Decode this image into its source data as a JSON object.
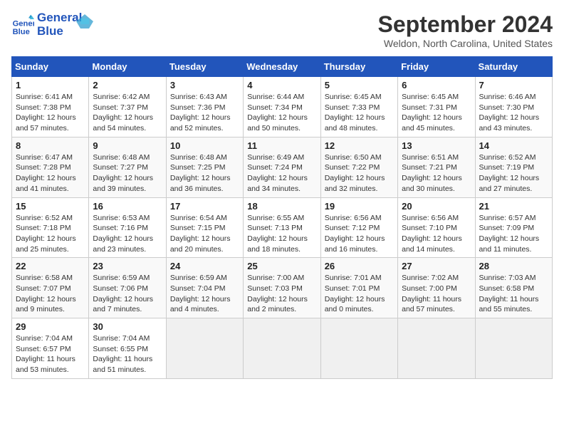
{
  "logo": {
    "line1": "General",
    "line2": "Blue"
  },
  "title": "September 2024",
  "location": "Weldon, North Carolina, United States",
  "weekdays": [
    "Sunday",
    "Monday",
    "Tuesday",
    "Wednesday",
    "Thursday",
    "Friday",
    "Saturday"
  ],
  "weeks": [
    [
      {
        "day": "1",
        "sunrise": "6:41 AM",
        "sunset": "7:38 PM",
        "daylight": "12 hours and 57 minutes."
      },
      {
        "day": "2",
        "sunrise": "6:42 AM",
        "sunset": "7:37 PM",
        "daylight": "12 hours and 54 minutes."
      },
      {
        "day": "3",
        "sunrise": "6:43 AM",
        "sunset": "7:36 PM",
        "daylight": "12 hours and 52 minutes."
      },
      {
        "day": "4",
        "sunrise": "6:44 AM",
        "sunset": "7:34 PM",
        "daylight": "12 hours and 50 minutes."
      },
      {
        "day": "5",
        "sunrise": "6:45 AM",
        "sunset": "7:33 PM",
        "daylight": "12 hours and 48 minutes."
      },
      {
        "day": "6",
        "sunrise": "6:45 AM",
        "sunset": "7:31 PM",
        "daylight": "12 hours and 45 minutes."
      },
      {
        "day": "7",
        "sunrise": "6:46 AM",
        "sunset": "7:30 PM",
        "daylight": "12 hours and 43 minutes."
      }
    ],
    [
      {
        "day": "8",
        "sunrise": "6:47 AM",
        "sunset": "7:28 PM",
        "daylight": "12 hours and 41 minutes."
      },
      {
        "day": "9",
        "sunrise": "6:48 AM",
        "sunset": "7:27 PM",
        "daylight": "12 hours and 39 minutes."
      },
      {
        "day": "10",
        "sunrise": "6:48 AM",
        "sunset": "7:25 PM",
        "daylight": "12 hours and 36 minutes."
      },
      {
        "day": "11",
        "sunrise": "6:49 AM",
        "sunset": "7:24 PM",
        "daylight": "12 hours and 34 minutes."
      },
      {
        "day": "12",
        "sunrise": "6:50 AM",
        "sunset": "7:22 PM",
        "daylight": "12 hours and 32 minutes."
      },
      {
        "day": "13",
        "sunrise": "6:51 AM",
        "sunset": "7:21 PM",
        "daylight": "12 hours and 30 minutes."
      },
      {
        "day": "14",
        "sunrise": "6:52 AM",
        "sunset": "7:19 PM",
        "daylight": "12 hours and 27 minutes."
      }
    ],
    [
      {
        "day": "15",
        "sunrise": "6:52 AM",
        "sunset": "7:18 PM",
        "daylight": "12 hours and 25 minutes."
      },
      {
        "day": "16",
        "sunrise": "6:53 AM",
        "sunset": "7:16 PM",
        "daylight": "12 hours and 23 minutes."
      },
      {
        "day": "17",
        "sunrise": "6:54 AM",
        "sunset": "7:15 PM",
        "daylight": "12 hours and 20 minutes."
      },
      {
        "day": "18",
        "sunrise": "6:55 AM",
        "sunset": "7:13 PM",
        "daylight": "12 hours and 18 minutes."
      },
      {
        "day": "19",
        "sunrise": "6:56 AM",
        "sunset": "7:12 PM",
        "daylight": "12 hours and 16 minutes."
      },
      {
        "day": "20",
        "sunrise": "6:56 AM",
        "sunset": "7:10 PM",
        "daylight": "12 hours and 14 minutes."
      },
      {
        "day": "21",
        "sunrise": "6:57 AM",
        "sunset": "7:09 PM",
        "daylight": "12 hours and 11 minutes."
      }
    ],
    [
      {
        "day": "22",
        "sunrise": "6:58 AM",
        "sunset": "7:07 PM",
        "daylight": "12 hours and 9 minutes."
      },
      {
        "day": "23",
        "sunrise": "6:59 AM",
        "sunset": "7:06 PM",
        "daylight": "12 hours and 7 minutes."
      },
      {
        "day": "24",
        "sunrise": "6:59 AM",
        "sunset": "7:04 PM",
        "daylight": "12 hours and 4 minutes."
      },
      {
        "day": "25",
        "sunrise": "7:00 AM",
        "sunset": "7:03 PM",
        "daylight": "12 hours and 2 minutes."
      },
      {
        "day": "26",
        "sunrise": "7:01 AM",
        "sunset": "7:01 PM",
        "daylight": "12 hours and 0 minutes."
      },
      {
        "day": "27",
        "sunrise": "7:02 AM",
        "sunset": "7:00 PM",
        "daylight": "11 hours and 57 minutes."
      },
      {
        "day": "28",
        "sunrise": "7:03 AM",
        "sunset": "6:58 PM",
        "daylight": "11 hours and 55 minutes."
      }
    ],
    [
      {
        "day": "29",
        "sunrise": "7:04 AM",
        "sunset": "6:57 PM",
        "daylight": "11 hours and 53 minutes."
      },
      {
        "day": "30",
        "sunrise": "7:04 AM",
        "sunset": "6:55 PM",
        "daylight": "11 hours and 51 minutes."
      },
      null,
      null,
      null,
      null,
      null
    ]
  ]
}
